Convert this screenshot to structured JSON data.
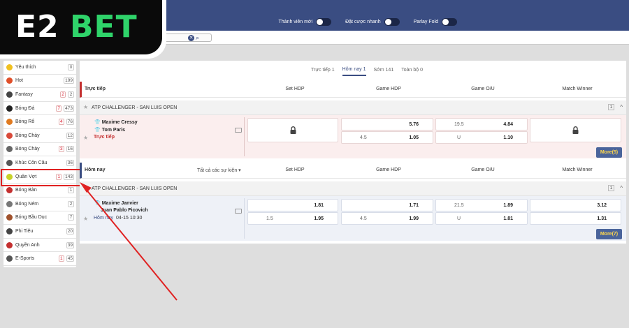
{
  "logo": {
    "part1": "E2",
    "part2": "BET"
  },
  "header": {
    "toggles": [
      {
        "label": "Thành viên mới"
      },
      {
        "label": "Đặt cược nhanh"
      },
      {
        "label": "Parlay Fold"
      }
    ],
    "clear_glyph": "✕",
    "search_glyph": "⌕"
  },
  "sidebar": {
    "items": [
      {
        "label": "Yêu thích",
        "live": "",
        "count": "0",
        "icon": "star-icon",
        "color": "#f0c020"
      },
      {
        "label": "Hot",
        "live": "",
        "count": "199",
        "icon": "fire-icon",
        "color": "#e0502a"
      },
      {
        "label": "Fantasy",
        "live": "2",
        "count": "2",
        "icon": "fantasy-icon",
        "color": "#444"
      },
      {
        "label": "Bóng Đá",
        "live": "7",
        "count": "473",
        "icon": "soccer-ball-icon",
        "color": "#222"
      },
      {
        "label": "Bóng Rổ",
        "live": "4",
        "count": "76",
        "icon": "basketball-icon",
        "color": "#e07a20"
      },
      {
        "label": "Bóng Chày",
        "live": "",
        "count": "12",
        "icon": "baseball-icon",
        "color": "#d94a3a"
      },
      {
        "label": "Bóng Chày",
        "live": "3",
        "count": "16",
        "icon": "baseball-alt-icon",
        "color": "#666"
      },
      {
        "label": "Khúc Côn Cầu",
        "live": "",
        "count": "36",
        "icon": "hockey-stick-icon",
        "color": "#555"
      },
      {
        "label": "Quần Vợt",
        "live": "1",
        "count": "143",
        "icon": "tennis-ball-icon",
        "color": "#c8d22a"
      },
      {
        "label": "Bóng Bàn",
        "live": "",
        "count": "1",
        "icon": "table-tennis-icon",
        "color": "#c43030"
      },
      {
        "label": "Bóng Ném",
        "live": "",
        "count": "2",
        "icon": "handball-icon",
        "color": "#777"
      },
      {
        "label": "Bóng Bầu Dục",
        "live": "",
        "count": "7",
        "icon": "rugby-ball-icon",
        "color": "#a0522d"
      },
      {
        "label": "Phi Tiêu",
        "live": "",
        "count": "20",
        "icon": "darts-icon",
        "color": "#444"
      },
      {
        "label": "Quyền Anh",
        "live": "",
        "count": "39",
        "icon": "boxing-glove-icon",
        "color": "#c43030"
      },
      {
        "label": "E-Sports",
        "live": "1",
        "count": "45",
        "icon": "gamepad-icon",
        "color": "#555"
      }
    ]
  },
  "tabs": [
    {
      "label": "Trực tiếp 1",
      "active": false
    },
    {
      "label": "Hôm nay 1",
      "active": true
    },
    {
      "label": "Sớm 141",
      "active": false
    },
    {
      "label": "Toàn bộ 0",
      "active": false
    }
  ],
  "columns": [
    "Set HDP",
    "Game HDP",
    "Game O/U",
    "Match Winner"
  ],
  "live_section": {
    "title": "Trực tiếp",
    "league": {
      "name": "ATP CHALLENGER - SAN LUIS OPEN",
      "count": "1"
    },
    "match": {
      "team1": "Maxime Cressy",
      "team2": "Tom Paris",
      "status": "Trực tiếp",
      "game_hdp": [
        {
          "line": "",
          "odds": "5.76"
        },
        {
          "line": "4.5",
          "odds": "1.05"
        }
      ],
      "game_ou": [
        {
          "line": "19.5",
          "odds": "4.84"
        },
        {
          "line": "U",
          "odds": "1.10"
        }
      ],
      "more": {
        "label": "More",
        "count": "(5)"
      }
    }
  },
  "today_section": {
    "title": "Hôm nay",
    "filter": "Tất cả các sự kiện ▾",
    "league": {
      "name": "ATP CHALLENGER - SAN LUIS OPEN",
      "count": "1"
    },
    "match": {
      "team1": "Maxime Janvier",
      "team2": "Juan Pablo Ficovich",
      "day": "Hôm nay",
      "time": "04-15 10:30",
      "set_hdp": [
        {
          "line": "",
          "odds": "1.81"
        },
        {
          "line": "1.5",
          "odds": "1.95"
        }
      ],
      "game_hdp": [
        {
          "line": "",
          "odds": "1.71"
        },
        {
          "line": "4.5",
          "odds": "1.99"
        }
      ],
      "game_ou": [
        {
          "line": "21.5",
          "odds": "1.89"
        },
        {
          "line": "U",
          "odds": "1.81"
        }
      ],
      "winner": [
        {
          "odds": "3.12"
        },
        {
          "odds": "1.31"
        }
      ],
      "more": {
        "label": "More",
        "count": "(7)"
      }
    }
  },
  "glyphs": {
    "star": "★",
    "caret": "^",
    "shirt": "👕"
  }
}
